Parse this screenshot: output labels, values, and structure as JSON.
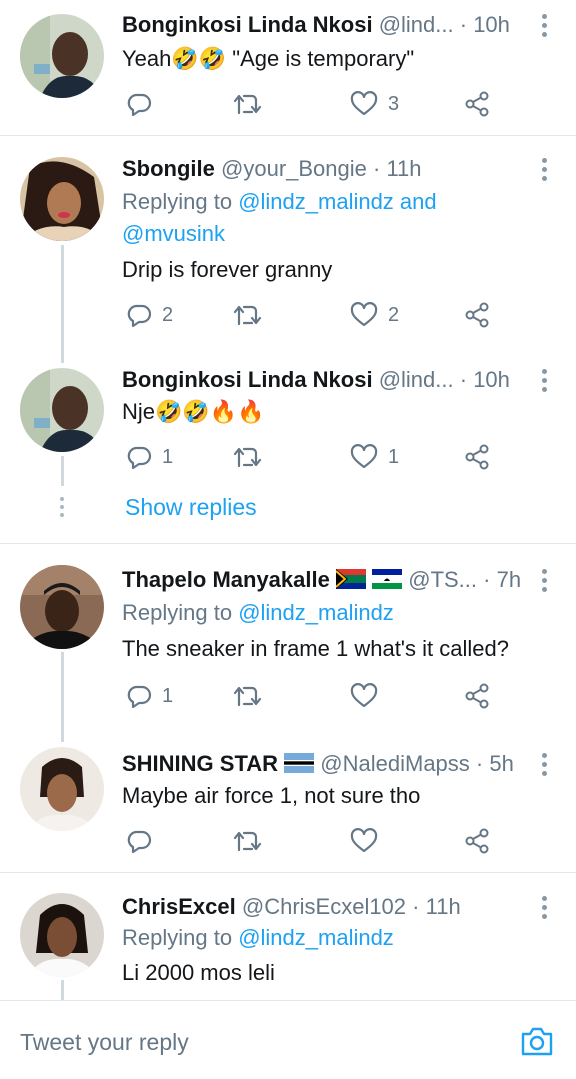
{
  "colors": {
    "accent": "#1da1f2",
    "muted": "#657786",
    "text": "#14171a"
  },
  "tweets": [
    {
      "name": "Bonginkosi Linda Nkosi",
      "handle": "@lind...",
      "time": "· 10h",
      "text": "Yeah🤣🤣 \"Age is temporary\"",
      "replies": "",
      "retweets": "",
      "likes": "3"
    },
    {
      "name": "Sbongile",
      "handle": "@your_Bongie",
      "time": "· 11h",
      "replying_prefix": "Replying to ",
      "replying_line1": "@lindz_malindz and",
      "replying_line2": "@mvusink",
      "text": "Drip is forever granny",
      "replies": "2",
      "retweets": "",
      "likes": "2"
    },
    {
      "name": "Bonginkosi Linda Nkosi",
      "handle": "@lind...",
      "time": "· 10h",
      "text": "Nje🤣🤣🔥🔥",
      "replies": "1",
      "retweets": "",
      "likes": "1"
    },
    {
      "name": "Thapelo Manyakalle",
      "handle": "@TS...",
      "time": "· 7h",
      "replying_prefix": "Replying to ",
      "replying_line1": "@lindz_malindz",
      "text": "The sneaker in frame 1 what's it called?",
      "replies": "1",
      "retweets": "",
      "likes": ""
    },
    {
      "name": "SHINING STAR",
      "handle": "@NalediMapss",
      "time": "· 5h",
      "text": "Maybe air force 1, not sure tho",
      "replies": "",
      "retweets": "",
      "likes": ""
    },
    {
      "name": "ChrisExcel",
      "handle": "@ChrisEcxel102",
      "time": "· 11h",
      "replying_prefix": "Replying to ",
      "replying_line1": "@lindz_malindz",
      "text": "Li 2000 mos leli"
    }
  ],
  "show_replies": "Show replies",
  "reply_bar": {
    "placeholder": "Tweet your reply",
    "camera_icon": "camera-icon"
  },
  "icons": {
    "reply": "reply-icon",
    "retweet": "retweet-icon",
    "like": "heart-icon",
    "share": "share-icon",
    "more": "more-vertical-icon"
  }
}
